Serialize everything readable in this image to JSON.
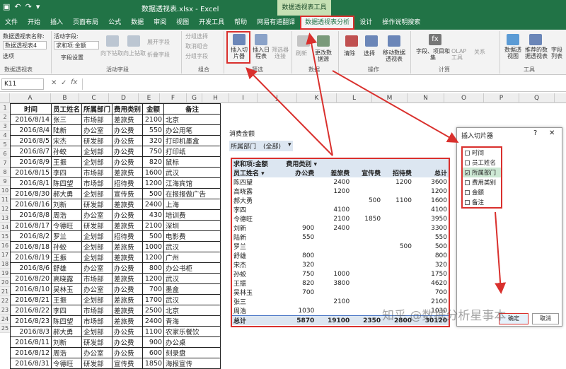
{
  "titlebar": {
    "title": "数据透视表.xlsx - Excel",
    "context_title": "数据透视表工具"
  },
  "tabs": [
    "文件",
    "开始",
    "插入",
    "页面布局",
    "公式",
    "数据",
    "审阅",
    "视图",
    "开发工具",
    "帮助",
    "网易有道翻译",
    "数据透视表分析",
    "设计",
    "操作说明搜索"
  ],
  "ribbon": {
    "pivot_name_label": "数据透视表名称:",
    "pivot_name": "数据透视表4",
    "options": "选项",
    "active_field_label": "活动字段:",
    "active_field": "求和项:金额",
    "field_settings": "字段设置",
    "drill_down": "向下钻取",
    "drill_up": "向上钻取",
    "expand": "展开字段",
    "collapse": "折叠字段",
    "group_sel": "分组选择",
    "ungroup": "取消组合",
    "group_field": "分组字段",
    "insert_slicer": "插入切片器",
    "insert_timeline": "插入日程表",
    "filter_conn": "筛选器连接",
    "refresh": "刷新",
    "change_source": "更改数据源",
    "clear": "清除",
    "select": "选择",
    "move": "移动数据透视表",
    "fields_items": "字段、项目和集",
    "olap": "OLAP 工具",
    "relationships": "关系",
    "pivotchart": "数据透视图",
    "recommended": "推荐的数据透视表",
    "field_list": "字段列表",
    "groups": {
      "pivot": "数据透视表",
      "active": "活动字段",
      "group": "组合",
      "filter": "筛选",
      "data": "数据",
      "actions": "操作",
      "calc": "计算",
      "tools": "工具"
    }
  },
  "namebox": "K11",
  "columns": [
    "A",
    "B",
    "C",
    "D",
    "E",
    "F",
    "G",
    "H",
    "I",
    "J",
    "K",
    "L",
    "M",
    "N",
    "O",
    "P",
    "Q"
  ],
  "source": {
    "headers": [
      "时间",
      "员工姓名",
      "所属部门",
      "费用类别",
      "金额",
      "备注"
    ],
    "rows": [
      [
        "2016/8/14",
        "张三",
        "市场部",
        "差旅费",
        "2100",
        "北京"
      ],
      [
        "2016/8/4",
        "陆新",
        "办公室",
        "办公费",
        "550",
        "办公用笔"
      ],
      [
        "2016/8/5",
        "宋杰",
        "研发部",
        "办公费",
        "320",
        "打印机墨盒"
      ],
      [
        "2016/8/7",
        "孙蛟",
        "企划部",
        "办公费",
        "750",
        "打印纸"
      ],
      [
        "2016/8/9",
        "王振",
        "企划部",
        "办公费",
        "820",
        "鼠标"
      ],
      [
        "2016/8/15",
        "李四",
        "市场部",
        "差旅费",
        "1600",
        "武汉"
      ],
      [
        "2016/8/1",
        "陈四望",
        "市场部",
        "招待费",
        "1200",
        "江海宾馆"
      ],
      [
        "2016/8/30",
        "郝大勇",
        "企划部",
        "宣传费",
        "500",
        "在报报做广告"
      ],
      [
        "2016/8/16",
        "刘新",
        "研发部",
        "差旅费",
        "2400",
        "上海"
      ],
      [
        "2016/8/8",
        "周浩",
        "办公室",
        "办公费",
        "430",
        "培训费"
      ],
      [
        "2016/8/17",
        "令德旺",
        "研发部",
        "差旅费",
        "2100",
        "深圳"
      ],
      [
        "2016/8/2",
        "罗兰",
        "企划部",
        "招待费",
        "500",
        "电影费"
      ],
      [
        "2016/8/18",
        "孙蛟",
        "企划部",
        "差旅费",
        "1000",
        "武汉"
      ],
      [
        "2016/8/19",
        "王振",
        "企划部",
        "差旅费",
        "1200",
        "广州"
      ],
      [
        "2016/8/6",
        "舒雄",
        "办公室",
        "办公费",
        "800",
        "办公书柜"
      ],
      [
        "2016/8/20",
        "高晓露",
        "市场部",
        "差旅费",
        "1200",
        "武汉"
      ],
      [
        "2016/8/10",
        "吴林玉",
        "办公室",
        "办公费",
        "700",
        "墨盒"
      ],
      [
        "2016/8/21",
        "王振",
        "企划部",
        "差旅费",
        "1700",
        "武汉"
      ],
      [
        "2016/8/22",
        "李四",
        "市场部",
        "差旅费",
        "2500",
        "北京"
      ],
      [
        "2016/8/23",
        "陈四望",
        "市场部",
        "差旅费",
        "2400",
        "青海"
      ],
      [
        "2016/8/3",
        "郝大勇",
        "企划部",
        "办公费",
        "1100",
        "农家乐餐饮"
      ],
      [
        "2016/8/11",
        "刘新",
        "研发部",
        "办公费",
        "900",
        "办公桌"
      ],
      [
        "2016/8/12",
        "周浩",
        "办公室",
        "办公费",
        "600",
        "刻录盘"
      ],
      [
        "2016/8/31",
        "令德旺",
        "研发部",
        "宣传费",
        "1850",
        "海报宣传"
      ]
    ]
  },
  "filter": {
    "title": "消费金额",
    "label": "所属部门",
    "value": "(全部)"
  },
  "pivot": {
    "header1": "求和项:金额",
    "header2": "费用类别",
    "cols": [
      "员工姓名",
      "办公费",
      "差旅费",
      "宣传费",
      "招待费",
      "总计"
    ],
    "rows": [
      [
        "陈四望",
        "",
        "2400",
        "",
        "1200",
        "3600"
      ],
      [
        "高晓露",
        "",
        "1200",
        "",
        "",
        "1200"
      ],
      [
        "郝大勇",
        "",
        "",
        "500",
        "1100",
        "1600"
      ],
      [
        "李四",
        "",
        "4100",
        "",
        "",
        "4100"
      ],
      [
        "令德旺",
        "",
        "2100",
        "1850",
        "",
        "3950"
      ],
      [
        "刘新",
        "900",
        "2400",
        "",
        "",
        "3300"
      ],
      [
        "陆新",
        "550",
        "",
        "",
        "",
        "550"
      ],
      [
        "罗兰",
        "",
        "",
        "",
        "500",
        "500"
      ],
      [
        "舒雄",
        "800",
        "",
        "",
        "",
        "800"
      ],
      [
        "宋杰",
        "320",
        "",
        "",
        "",
        "320"
      ],
      [
        "孙蛟",
        "750",
        "1000",
        "",
        "",
        "1750"
      ],
      [
        "王振",
        "820",
        "3800",
        "",
        "",
        "4620"
      ],
      [
        "吴林玉",
        "700",
        "",
        "",
        "",
        "700"
      ],
      [
        "张三",
        "",
        "2100",
        "",
        "",
        "2100"
      ],
      [
        "周浩",
        "1030",
        "",
        "",
        "",
        "1030"
      ]
    ],
    "total": [
      "总计",
      "5870",
      "19100",
      "2350",
      "2800",
      "30120"
    ]
  },
  "panel": {
    "title": "插入切片器",
    "help": "?",
    "close": "✕",
    "options": [
      {
        "label": "时间",
        "checked": false
      },
      {
        "label": "员工姓名",
        "checked": false
      },
      {
        "label": "所属部门",
        "checked": true
      },
      {
        "label": "费用类别",
        "checked": false
      },
      {
        "label": "金额",
        "checked": false
      },
      {
        "label": "备注",
        "checked": false
      }
    ],
    "ok": "确定",
    "cancel": "取消"
  },
  "watermark": "知乎 @数据分析星事本",
  "colors": {
    "excel_green": "#217346",
    "highlight_red": "#d9302d",
    "pivot_header": "#dce6f1"
  }
}
